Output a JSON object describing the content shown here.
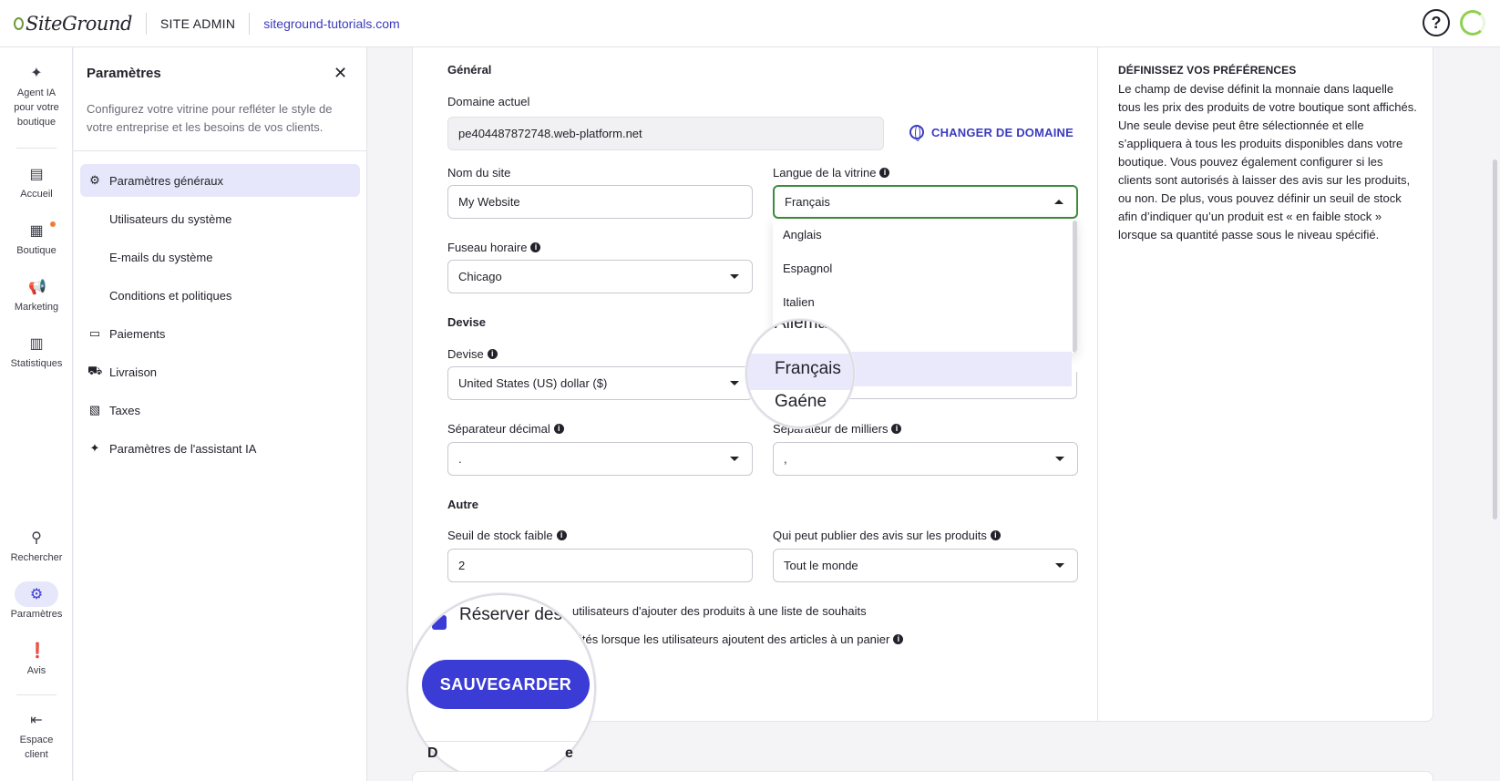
{
  "topbar": {
    "logo_text": "SiteGround",
    "site_admin": "SITE ADMIN",
    "domain": "siteground-tutorials.com",
    "help_glyph": "?"
  },
  "rail": {
    "items": [
      {
        "label_1": "Agent IA",
        "label_2": "pour votre",
        "label_3": "boutique",
        "icon": "sparkle-icon",
        "glyph": "✦"
      },
      {
        "label": "Accueil",
        "icon": "home-icon",
        "glyph": "▤"
      },
      {
        "label": "Boutique",
        "icon": "store-icon",
        "glyph": "▦"
      },
      {
        "label": "Marketing",
        "icon": "megaphone-icon",
        "glyph": "📢"
      },
      {
        "label": "Statistiques",
        "icon": "stats-icon",
        "glyph": "▥"
      },
      {
        "label": "Rechercher",
        "icon": "search-icon",
        "glyph": "⚲"
      },
      {
        "label": "Paramètres",
        "icon": "gear-icon",
        "glyph": "⚙"
      },
      {
        "label": "Avis",
        "icon": "review-icon",
        "glyph": "❗"
      },
      {
        "label_1": "Espace",
        "label_2": "client",
        "icon": "exit-icon",
        "glyph": "⇤"
      }
    ]
  },
  "panel": {
    "title": "Paramètres",
    "close_glyph": "✕",
    "description": "Configurez votre vitrine pour refléter le style de votre entreprise et les besoins de vos clients.",
    "nav": [
      {
        "label": "Paramètres généraux",
        "glyph": "⚙"
      },
      {
        "label": "Utilisateurs du système"
      },
      {
        "label": "E-mails du système"
      },
      {
        "label": "Conditions et politiques"
      },
      {
        "label": "Paiements",
        "glyph": "▭"
      },
      {
        "label": "Livraison",
        "glyph": "⛟"
      },
      {
        "label": "Taxes",
        "glyph": "▧"
      },
      {
        "label": "Paramètres de l'assistant IA",
        "glyph": "✦"
      }
    ]
  },
  "form": {
    "general_title": "Général",
    "domain_label": "Domaine actuel",
    "domain_value": "pe404487872748.web-platform.net",
    "change_domain": "CHANGER DE DOMAINE",
    "site_name_label": "Nom du site",
    "site_name_value": "My Website",
    "language_label": "Langue de la vitrine",
    "language_value": "Français",
    "language_options": [
      "Anglais",
      "Espagnol",
      "Italien"
    ],
    "language_partial_above": "Allema",
    "language_partial_below": "Gaéne",
    "timezone_label": "Fuseau horaire",
    "timezone_value": "Chicago",
    "currency_title": "Devise",
    "currency_label": "Devise",
    "currency_value": "United States (US) dollar ($)",
    "decimal_label": "Séparateur décimal",
    "decimal_value": ".",
    "thousands_label": "Séparateur de milliers",
    "thousands_value": ",",
    "other_title": "Autre",
    "stock_label": "Seuil de stock faible",
    "stock_value": "2",
    "reviews_label": "Qui peut publier des avis sur les produits",
    "reviews_value": "Tout le monde",
    "wishlist_text_partial": "Réserver des",
    "wishlist_text_rest": "utilisateurs d'ajouter des produits à une liste de souhaits",
    "cart_text_rest": "ités lorsque les utilisateurs ajoutent des articles à un panier",
    "save_label": "SAUVEGARDER",
    "lower_title_partial_1": "D",
    "lower_title_partial_2": "e"
  },
  "help": {
    "title": "DÉFINISSEZ VOS PRÉFÉRENCES",
    "body": "Le champ de devise définit la monnaie dans laquelle tous les prix des produits de votre boutique sont affichés. Une seule devise peut être sélectionnée et elle s’appliquera à tous les produits disponibles dans votre boutique. Vous pouvez également configurer si les clients sont autorisés à laisser des avis sur les produits, ou non. De plus, vous pouvez définir un seuil de stock afin d’indiquer qu’un produit est « en faible stock » lorsque sa quantité passe sous le niveau spécifié."
  },
  "colors": {
    "accent": "#3b3bd6",
    "link": "#3b3bbf",
    "focus_border": "#3d8b3d",
    "selected_bg": "#e9e9fb",
    "notification_dot": "#f07c3c"
  }
}
